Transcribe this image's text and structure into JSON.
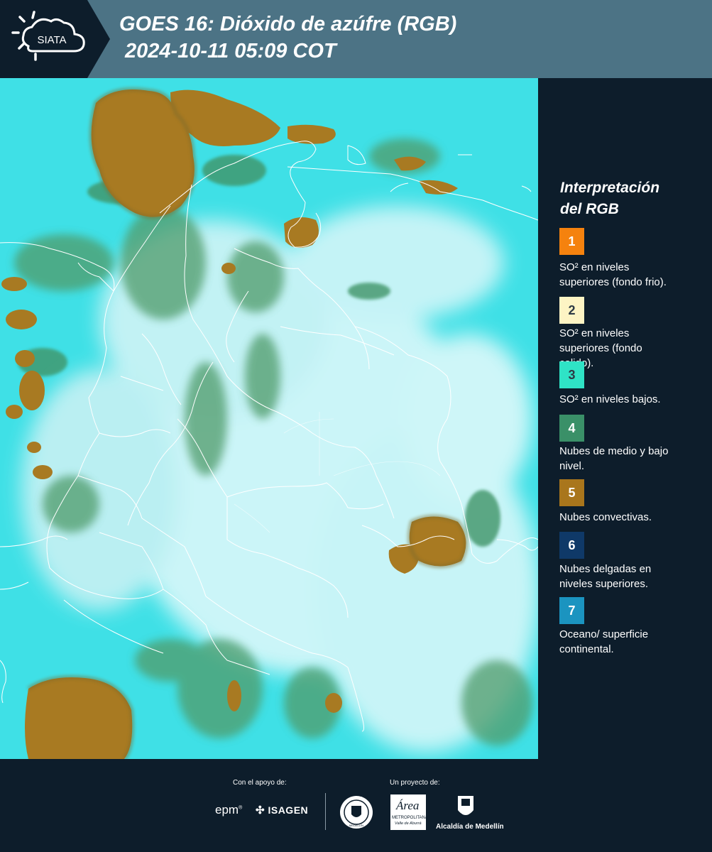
{
  "header": {
    "logo_text": "SIATA",
    "title_line1": "GOES 16: Dióxido de azúfre (RGB)",
    "title_line2": "2024-10-11 05:09 COT",
    "background": "#4c7385",
    "logo_background": "#0d1d2b"
  },
  "map": {
    "product": "GOES 16 Sulfur Dioxide RGB satellite image",
    "ocean_color": "#3fe0e6",
    "cloud_color": "#eef9fb",
    "convective_color": "#a87a22",
    "mid_low_color": "#4a9a6a",
    "border_color": "#ffffff"
  },
  "legend": {
    "title_line1": "Interpretación",
    "title_line2": "del RGB",
    "items": [
      {
        "num": "1",
        "color": "#f5820e",
        "text_color": "#ffffff",
        "line1": "SO² en niveles",
        "line2": "superiores (fondo frio)."
      },
      {
        "num": "2",
        "color": "#fdf4c4",
        "text_color": "#2d3a45",
        "line1": "SO² en niveles",
        "line2": "superiores (fondo",
        "line3": "calido)."
      },
      {
        "num": "3",
        "color": "#2fe3c6",
        "text_color": "#2d3a45",
        "line1": "SO² en niveles bajos."
      },
      {
        "num": "4",
        "color": "#3a9068",
        "text_color": "#ffffff",
        "line1": "Nubes de medio y bajo",
        "line2": "nivel."
      },
      {
        "num": "5",
        "color": "#a9761c",
        "text_color": "#ffffff",
        "line1": "Nubes convectivas."
      },
      {
        "num": "6",
        "color": "#0f3968",
        "text_color": "#ffffff",
        "line1": "Nubes delgadas en",
        "line2": "niveles superiores."
      },
      {
        "num": "7",
        "color": "#1b94c0",
        "text_color": "#ffffff",
        "line1": "Oceano/ superficie",
        "line2": "continental."
      }
    ]
  },
  "footer": {
    "support_label": "Con el apoyo de:",
    "project_label": "Un proyecto de:",
    "epm": "epm",
    "isagen": "ISAGEN",
    "seal_text": "MEDELLÍN",
    "area_name": "Área",
    "area_sub1": "METROPOLITANA",
    "area_sub2": "Valle de Aburrá",
    "alcaldia": "Alcaldía de Medellín"
  }
}
